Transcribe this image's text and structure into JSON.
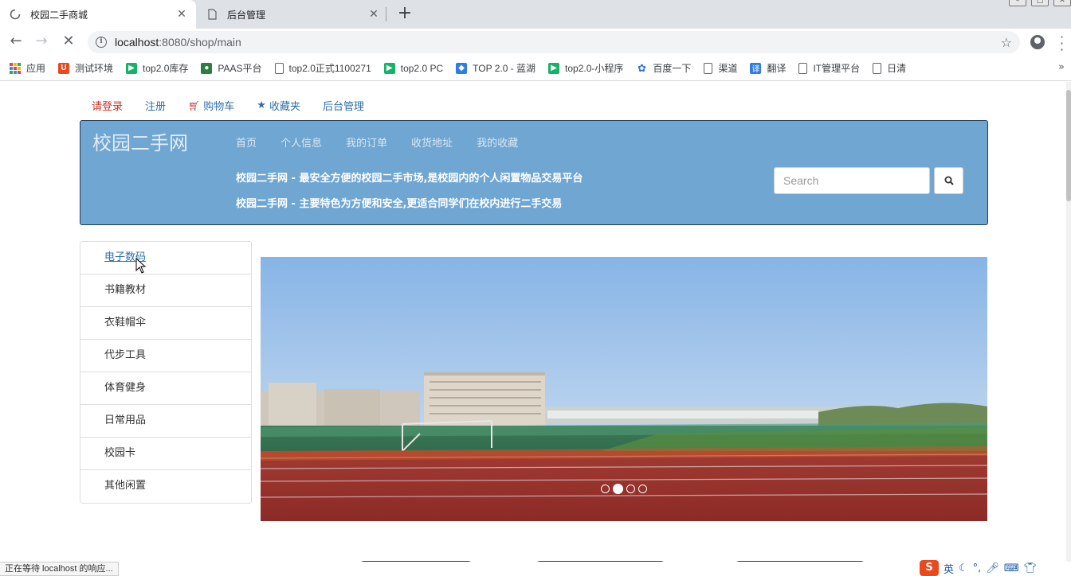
{
  "browser": {
    "tabs": [
      {
        "title": "校园二手商城",
        "active": true
      },
      {
        "title": "后台管理",
        "active": false
      }
    ],
    "new_tab": "+",
    "url_host": "localhost",
    "url_path": ":8080/shop/main",
    "bookmarks": [
      {
        "label": "应用",
        "icon": "apps-grid-icon"
      },
      {
        "label": "测试环境",
        "icon": "u-logo-icon"
      },
      {
        "label": "top2.0库存",
        "icon": "play-icon"
      },
      {
        "label": "PAAS平台",
        "icon": "paas-logo-icon"
      },
      {
        "label": "top2.0正式1100271",
        "icon": "page-icon"
      },
      {
        "label": "top2.0 PC",
        "icon": "play-icon"
      },
      {
        "label": "TOP 2.0 - 蓝湖",
        "icon": "bird-logo-icon"
      },
      {
        "label": "top2.0-小程序",
        "icon": "play-icon"
      },
      {
        "label": "百度一下",
        "icon": "paw-icon"
      },
      {
        "label": "渠道",
        "icon": "page-icon"
      },
      {
        "label": "翻译",
        "icon": "translate-icon"
      },
      {
        "label": "IT管理平台",
        "icon": "page-icon"
      },
      {
        "label": "日清",
        "icon": "page-icon"
      }
    ],
    "status_text": "正在等待 localhost 的响应..."
  },
  "top_links": {
    "login": "请登录",
    "register": "注册",
    "cart": "购物车",
    "favorites": "收藏夹",
    "admin": "后台管理"
  },
  "banner": {
    "brand": "校园二手网",
    "nav": [
      "首页",
      "个人信息",
      "我的订单",
      "收货地址",
      "我的收藏"
    ],
    "slogan_1": "校园二手网 - 最安全方便的校园二手市场,是校园内的个人闲置物品交易平台",
    "slogan_2": "校园二手网 - 主要特色为方便和安全,更适合同学们在校内进行二手交易",
    "search_placeholder": "Search"
  },
  "categories": [
    "电子数码",
    "书籍教材",
    "衣鞋帽伞",
    "代步工具",
    "体育健身",
    "日常用品",
    "校园卡",
    "其他闲置"
  ],
  "carousel": {
    "slide_count": 4,
    "active_index": 1
  },
  "ime": {
    "logo": "S",
    "mode": "英"
  },
  "colors": {
    "banner_bg": "#6fa6d2",
    "link_blue": "#2f6fad",
    "login_red": "#c9302c"
  }
}
